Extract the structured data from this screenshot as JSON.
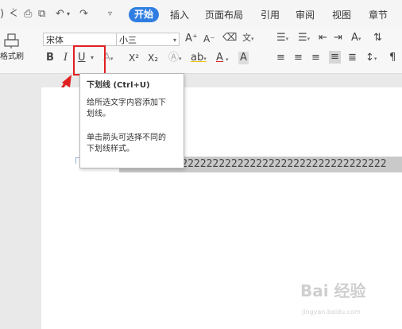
{
  "quick_access": {
    "icons": [
      "undo-icon",
      "redo-icon",
      "print-icon",
      "print-preview-icon",
      "undo-arrow-icon",
      "redo-arrow-icon",
      "dropdown-icon"
    ]
  },
  "tabs": [
    {
      "label": "开始",
      "active": true
    },
    {
      "label": "插入"
    },
    {
      "label": "页面布局"
    },
    {
      "label": "引用"
    },
    {
      "label": "审阅"
    },
    {
      "label": "视图"
    },
    {
      "label": "章节"
    }
  ],
  "ribbon": {
    "format_painter_label": "格式刷",
    "font_name": "宋体",
    "font_size": "小三",
    "bold": "B",
    "italic": "I",
    "underline": "U",
    "font_color_letter": "A",
    "superscript": "X²",
    "subscript": "X₂",
    "grow_font": "A⁺",
    "shrink_font": "A⁻"
  },
  "tooltip": {
    "title": "下划线 (Ctrl+U)",
    "desc1_line1": "给所选文字内容添加下",
    "desc1_line2": "划线。",
    "desc2_line1": "单击箭头可选择不同的",
    "desc2_line2": "下划线样式。"
  },
  "document": {
    "text": "2222222222222222222222222222222222222222222"
  },
  "watermark": {
    "main": "Bai 经验",
    "sub": "jingyan.baidu.com"
  },
  "colors": {
    "accent": "#2f7de1",
    "highlight_box": "#e02020",
    "font_color_bar": "#e02020"
  }
}
